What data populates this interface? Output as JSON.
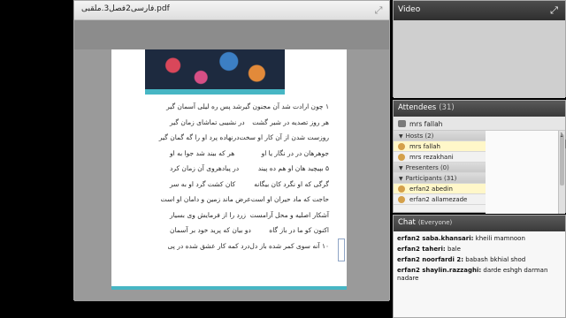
{
  "document_pod": {
    "title": "فارسی2فصل3.ملقبی.pdf",
    "expand_icon": "expand-arrows-icon",
    "verses": [
      [
        "۱ چون ارادت شد آن مجنون گیر",
        "شد پس ره لیلی آسمان گیر"
      ],
      [
        "هر روز تصدیه در شیر گشت",
        "در نشیبی تماشای زمان گیر"
      ],
      [
        "روزست شدن از آن کار او سخت",
        "درنهاده پرد او را گه گمان گیر"
      ],
      [
        "جوهرهان در در نگار یا او",
        "هر که بیند شد جوا به او"
      ],
      [
        "۵ بپیچید هان او هم ده پیند",
        "در پیادهروی آن زمان کرد"
      ],
      [
        "گرگی که او نگرد کان بیگانه",
        "کان کشت گرد او به سر"
      ],
      [
        "حاجت که ماد حیران او است",
        "عرض ماند زمین و دامان او است"
      ],
      [
        "آشکار اصلیه و محل آرامست",
        "زرد را از فرمایش وی بسیار"
      ],
      [
        "اکنون کو ما در باز گاه",
        "دو بیان که پرید خود بر آسمان"
      ],
      [
        "۱۰ آنه سوی کمر شده باز دل",
        "درد کمه کار عشق شده در پی"
      ]
    ]
  },
  "video_pod": {
    "title": "Video",
    "expand_icon": "expand-arrows-icon"
  },
  "attendees_pod": {
    "title": "Attendees",
    "count": "(31)",
    "me": "mrs fallah",
    "hosts_header": "Hosts (2)",
    "hosts": [
      "mrs fallah",
      "mrs rezakhani"
    ],
    "presenters_header": "Presenters (0)",
    "participants_header": "Participants (31)",
    "participants": [
      "erfan2 abedin",
      "erfan2 allamezade"
    ],
    "scroll_number": "1"
  },
  "chat_pod": {
    "title": "Chat",
    "scope": "(Everyone)",
    "messages": [
      {
        "who": "erfan2 saba.khansari:",
        "text": "kheili mamnoon"
      },
      {
        "who": "erfan2 taheri:",
        "text": "bale"
      },
      {
        "who": "erfan2 noorfardi 2:",
        "text": "babash bkhial shod"
      },
      {
        "who": "erfan2 shaylin.razzaghi:",
        "text": "darde eshgh darman nadare"
      }
    ]
  }
}
